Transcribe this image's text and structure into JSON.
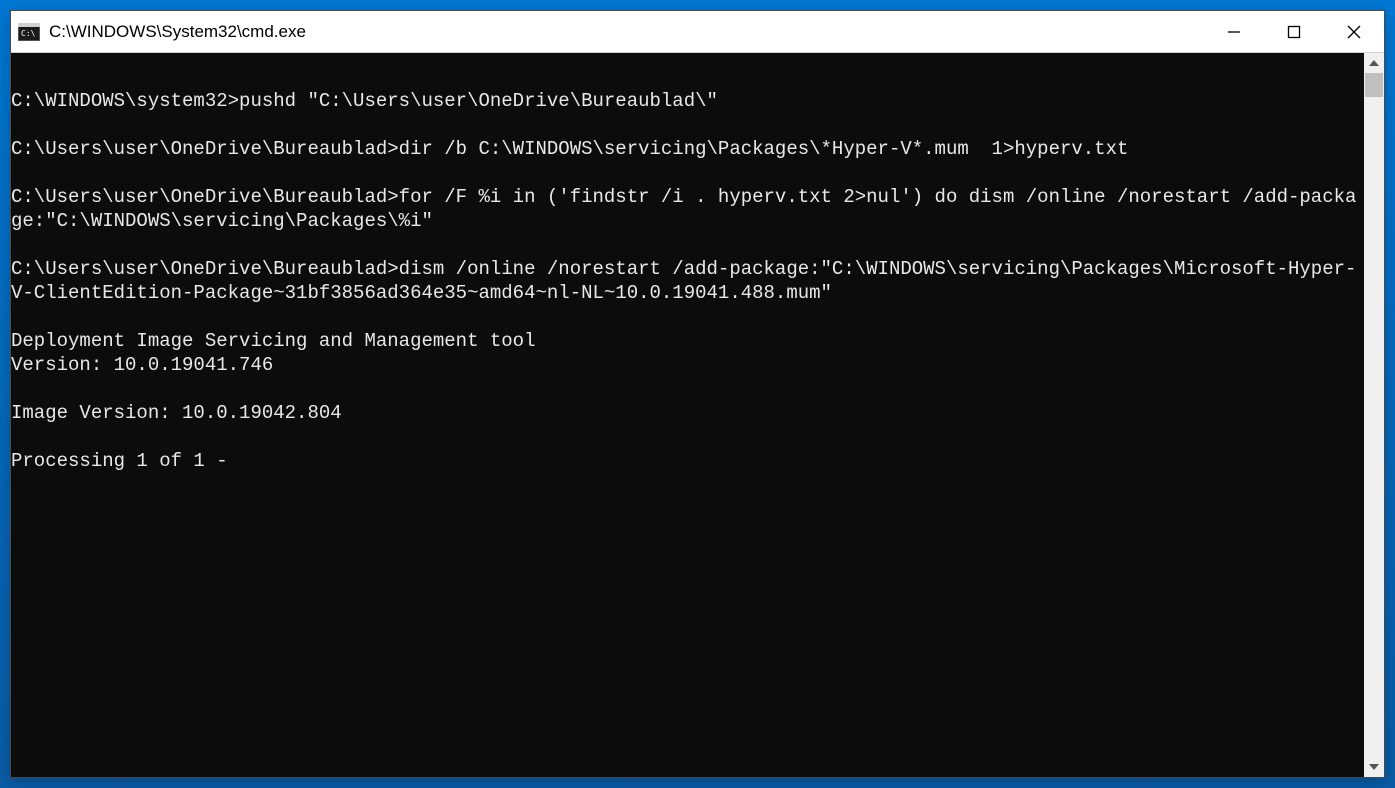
{
  "window": {
    "title": "C:\\WINDOWS\\System32\\cmd.exe"
  },
  "terminal": {
    "lines": [
      "",
      "C:\\WINDOWS\\system32>pushd \"C:\\Users\\user\\OneDrive\\Bureaublad\\\"",
      "",
      "C:\\Users\\user\\OneDrive\\Bureaublad>dir /b C:\\WINDOWS\\servicing\\Packages\\*Hyper-V*.mum  1>hyperv.txt",
      "",
      "C:\\Users\\user\\OneDrive\\Bureaublad>for /F %i in ('findstr /i . hyperv.txt 2>nul') do dism /online /norestart /add-package:\"C:\\WINDOWS\\servicing\\Packages\\%i\"",
      "",
      "C:\\Users\\user\\OneDrive\\Bureaublad>dism /online /norestart /add-package:\"C:\\WINDOWS\\servicing\\Packages\\Microsoft-Hyper-V-ClientEdition-Package~31bf3856ad364e35~amd64~nl-NL~10.0.19041.488.mum\"",
      "",
      "Deployment Image Servicing and Management tool",
      "Version: 10.0.19041.746",
      "",
      "Image Version: 10.0.19042.804",
      "",
      "Processing 1 of 1 -"
    ]
  }
}
